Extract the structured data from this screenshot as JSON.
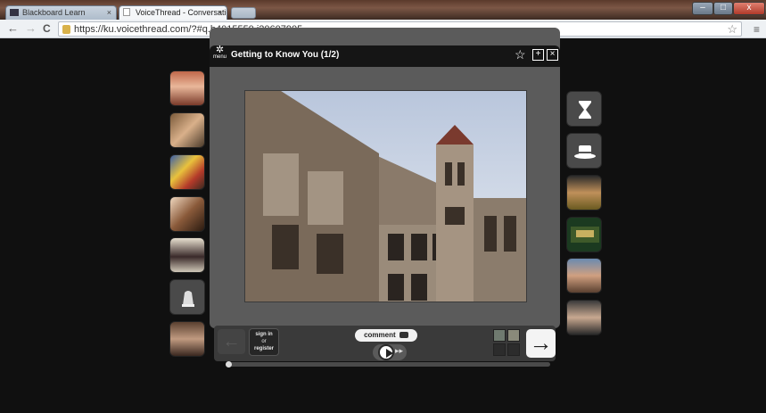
{
  "browser": {
    "tabs": [
      {
        "title": "Blackboard Learn",
        "active": false
      },
      {
        "title": "VoiceThread - Conversatio",
        "active": true
      }
    ],
    "tab_close": "×",
    "url": "https://ku.voicethread.com/?#q.b4015550.i20607905",
    "nav": {
      "back": "←",
      "forward": "→",
      "reload": "C",
      "bookmark_star": "☆",
      "menu": "≡"
    },
    "window_controls": {
      "minimize": "–",
      "maximize": "□",
      "close": "x"
    }
  },
  "voicethread": {
    "menu_label": "menu",
    "title": "Getting to Know You (1/2)",
    "sign_in": {
      "line1": "sign in",
      "line2": "or",
      "line3": "register"
    },
    "comment_label": "comment",
    "icons": {
      "gear": "gear-icon",
      "star": "star-icon",
      "edit": "edit-icon",
      "close": "close-icon",
      "hourglass": "hourglass-icon",
      "hat": "hat-icon",
      "thimble": "thimble-icon"
    },
    "left_commenters": [
      "commenter-1",
      "commenter-2",
      "commenter-3",
      "commenter-4",
      "commenter-5",
      "commenter-6"
    ],
    "right_commenters": [
      "commenter-7",
      "commenter-8",
      "commenter-9",
      "commenter-10"
    ]
  }
}
